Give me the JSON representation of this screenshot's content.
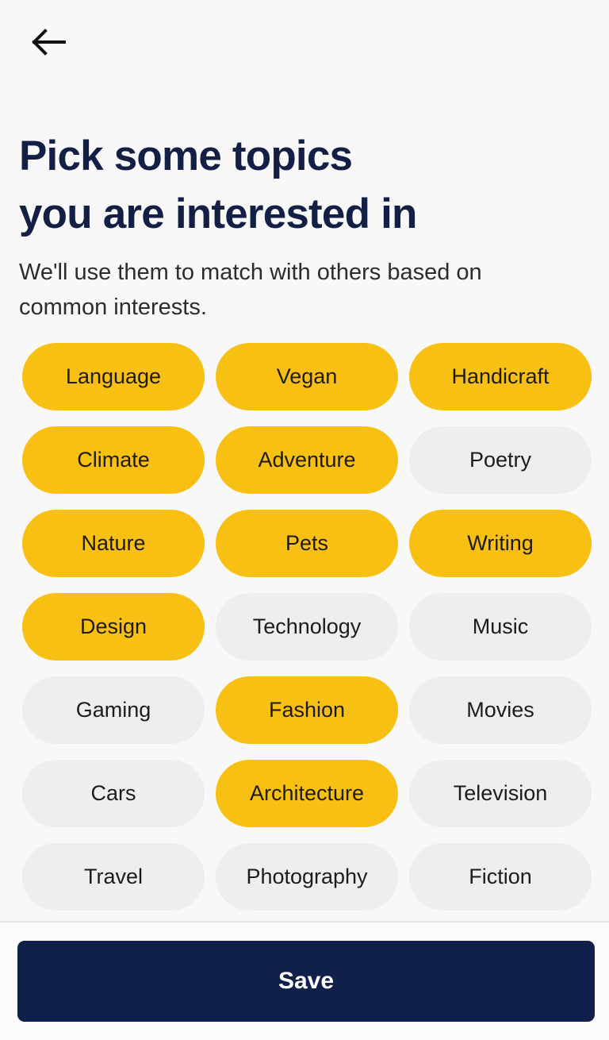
{
  "colors": {
    "background": "#f8f8f8",
    "chip_selected": "#f9c014",
    "chip_unselected": "#eeeeee",
    "heading": "#131f45",
    "primary_button": "#11204a",
    "primary_button_text": "#ffffff"
  },
  "header": {
    "back_icon": "arrow-left-icon",
    "title": "Pick some topics\nyou are interested in",
    "subtitle": "We'll use them to match with others based on common interests."
  },
  "topics": [
    {
      "label": "Language",
      "selected": true
    },
    {
      "label": "Vegan",
      "selected": true
    },
    {
      "label": "Handicraft",
      "selected": true
    },
    {
      "label": "Climate",
      "selected": true
    },
    {
      "label": "Adventure",
      "selected": true
    },
    {
      "label": "Poetry",
      "selected": false
    },
    {
      "label": "Nature",
      "selected": true
    },
    {
      "label": "Pets",
      "selected": true
    },
    {
      "label": "Writing",
      "selected": true
    },
    {
      "label": "Design",
      "selected": true
    },
    {
      "label": "Technology",
      "selected": false
    },
    {
      "label": "Music",
      "selected": false
    },
    {
      "label": "Gaming",
      "selected": false
    },
    {
      "label": "Fashion",
      "selected": true
    },
    {
      "label": "Movies",
      "selected": false
    },
    {
      "label": "Cars",
      "selected": false
    },
    {
      "label": "Architecture",
      "selected": true
    },
    {
      "label": "Television",
      "selected": false
    },
    {
      "label": "Travel",
      "selected": false
    },
    {
      "label": "Photography",
      "selected": false
    },
    {
      "label": "Fiction",
      "selected": false
    }
  ],
  "footer": {
    "save_label": "Save"
  }
}
